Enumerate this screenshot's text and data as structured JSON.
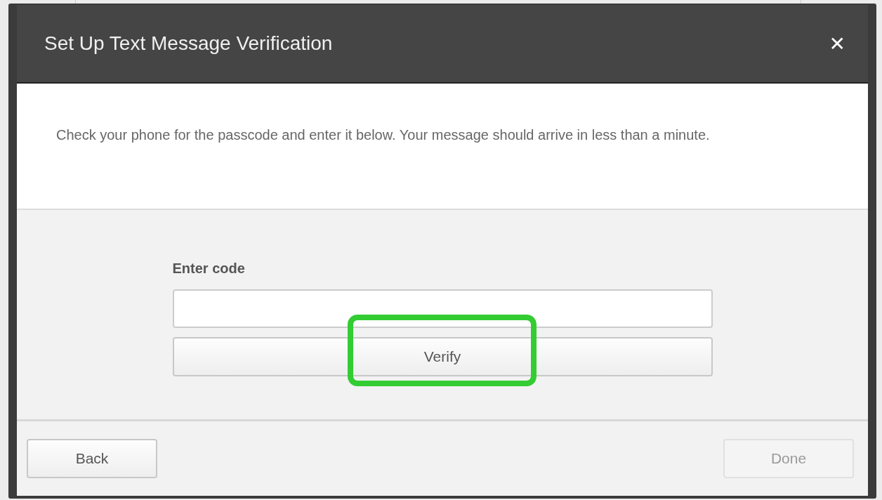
{
  "dialog": {
    "title": "Set Up Text Message Verification",
    "close_icon": "✕"
  },
  "message": "Check your phone for the passcode and enter it below. Your message should arrive in less than a minute.",
  "code_field": {
    "label": "Enter code"
  },
  "verify_button": {
    "label": "Verify",
    "highlighted": true
  },
  "footer_buttons": [
    {
      "label": "Back",
      "disabled": false
    },
    {
      "label": "Done",
      "disabled": true
    }
  ]
}
